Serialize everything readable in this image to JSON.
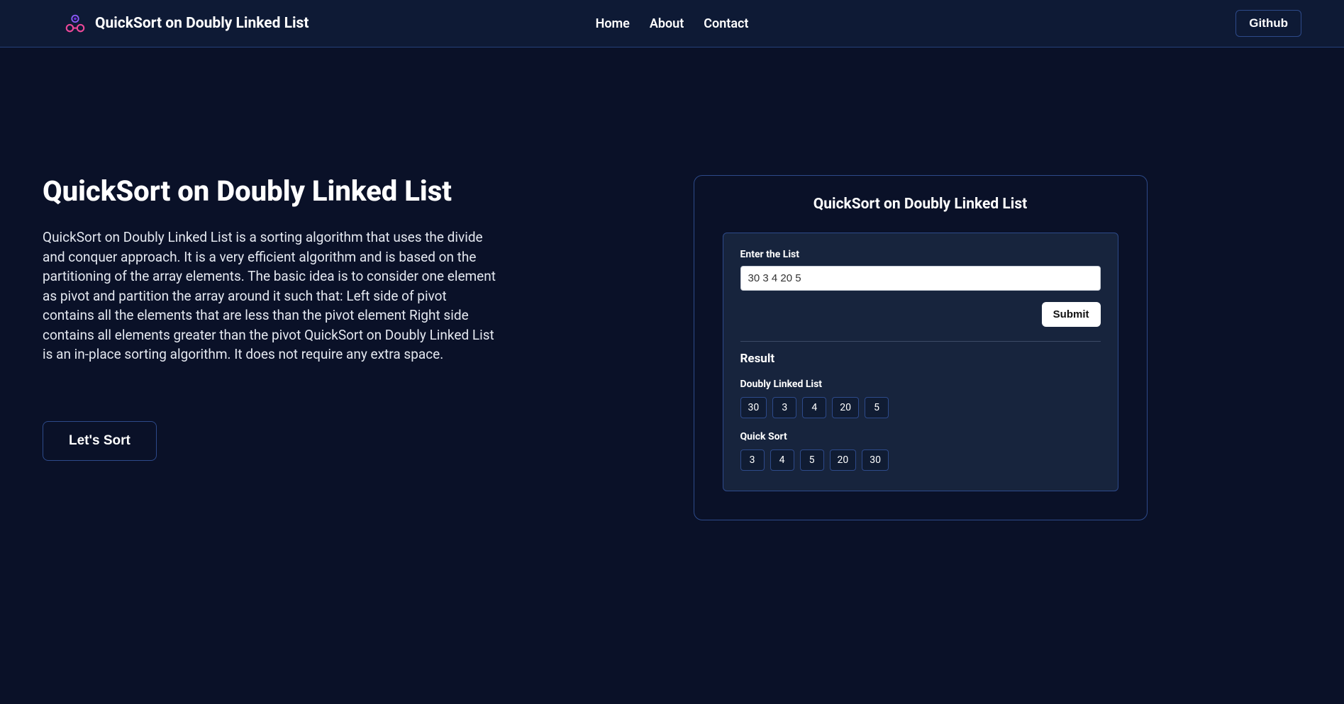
{
  "header": {
    "brand": "QuickSort on Doubly Linked List",
    "nav": {
      "home": "Home",
      "about": "About",
      "contact": "Contact"
    },
    "github": "Github"
  },
  "hero": {
    "title": "QuickSort on Doubly Linked List",
    "description": "QuickSort on Doubly Linked List is a sorting algorithm that uses the divide and conquer approach. It is a very efficient algorithm and is based on the partitioning of the array elements. The basic idea is to consider one element as pivot and partition the array around it such that: Left side of pivot contains all the elements that are less than the pivot element Right side contains all elements greater than the pivot QuickSort on Doubly Linked List is an in-place sorting algorithm. It does not require any extra space.",
    "cta": "Let's Sort"
  },
  "panel": {
    "title": "QuickSort on Doubly Linked List",
    "form": {
      "label": "Enter the List",
      "value": "30 3 4 20 5",
      "submit": "Submit"
    },
    "result": {
      "heading": "Result",
      "dll_label": "Doubly Linked List",
      "dll_values": [
        "30",
        "3",
        "4",
        "20",
        "5"
      ],
      "sorted_label": "Quick Sort",
      "sorted_values": [
        "3",
        "4",
        "5",
        "20",
        "30"
      ]
    }
  }
}
